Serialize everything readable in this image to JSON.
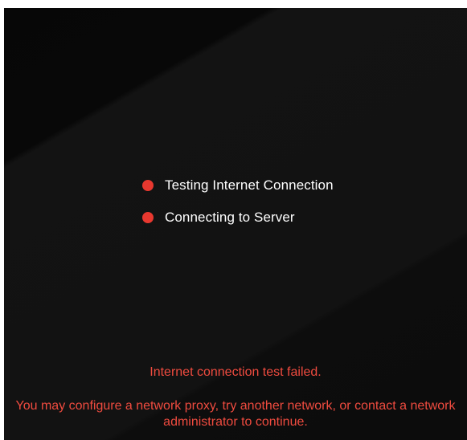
{
  "status": {
    "items": [
      {
        "icon": "status-dot-red",
        "label": "Testing Internet Connection"
      },
      {
        "icon": "status-dot-red",
        "label": "Connecting to Server"
      }
    ]
  },
  "error": {
    "title": "Internet connection test failed.",
    "hint": "You may configure a network proxy, try another network, or contact a network administrator to continue."
  },
  "colors": {
    "status_dot": "#e8382f",
    "error_text": "#ef4b3f",
    "label_text": "#ffffff",
    "background": "#0f0f0f"
  }
}
